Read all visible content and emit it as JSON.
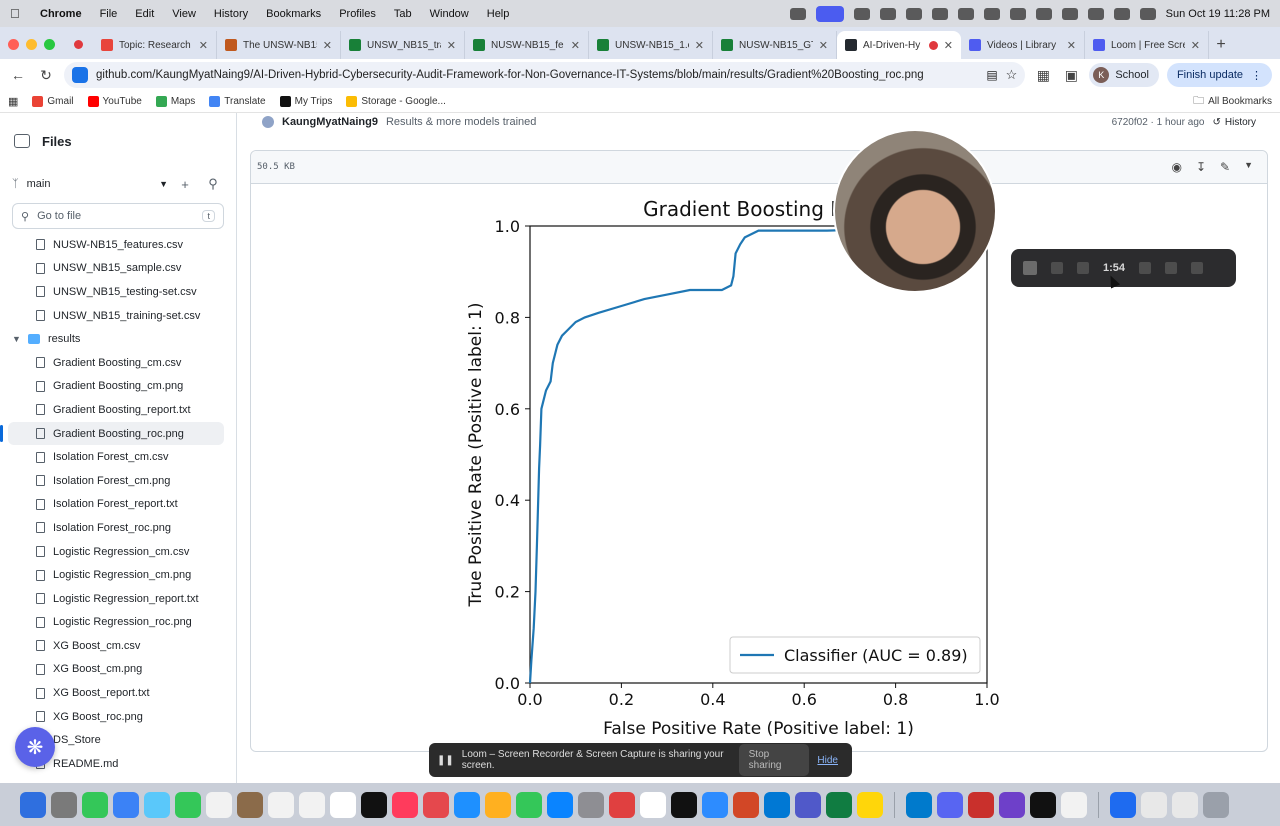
{
  "menubar": {
    "app": "Chrome",
    "items": [
      "File",
      "Edit",
      "View",
      "History",
      "Bookmarks",
      "Profiles",
      "Tab",
      "Window",
      "Help"
    ],
    "clock": "Sun Oct 19  11:28 PM"
  },
  "tabs": [
    {
      "title": "Topic: Research",
      "color": "#e8453c",
      "active": false
    },
    {
      "title": "The UNSW-NB15",
      "color": "#c0591e",
      "active": false
    },
    {
      "title": "UNSW_NB15_tra",
      "color": "#188038",
      "active": false
    },
    {
      "title": "NUSW-NB15_fe",
      "color": "#188038",
      "active": false
    },
    {
      "title": "UNSW-NB15_1.c",
      "color": "#188038",
      "active": false
    },
    {
      "title": "NUSW-NB15_GT",
      "color": "#188038",
      "active": false
    },
    {
      "title": "AI-Driven-Hy",
      "color": "#24292f",
      "active": true
    },
    {
      "title": "Videos | Library",
      "color": "#4f5cf0",
      "active": false
    },
    {
      "title": "Loom | Free Scre",
      "color": "#4f5cf0",
      "active": false
    }
  ],
  "toolbar": {
    "url": "github.com/KaungMyatNaing9/AI-Driven-Hybrid-Cybersecurity-Audit-Framework-for-Non-Governance-IT-Systems/blob/main/results/Gradient%20Boosting_roc.png",
    "profile_label": "School",
    "profile_initial": "K",
    "finish_label": "Finish update"
  },
  "bookmarks": {
    "items": [
      {
        "label": "Gmail",
        "color": "#ea4335"
      },
      {
        "label": "YouTube",
        "color": "#ff0000"
      },
      {
        "label": "Maps",
        "color": "#34a853"
      },
      {
        "label": "Translate",
        "color": "#4285f4"
      },
      {
        "label": "My Trips",
        "color": "#111111"
      },
      {
        "label": "Storage - Google...",
        "color": "#fbbc04"
      }
    ],
    "all_label": "All Bookmarks"
  },
  "sidebar": {
    "title": "Files",
    "branch": "main",
    "goto_placeholder": "Go to file",
    "goto_key": "t",
    "files_top": [
      "NUSW-NB15_features.csv",
      "UNSW_NB15_sample.csv",
      "UNSW_NB15_testing-set.csv",
      "UNSW_NB15_training-set.csv"
    ],
    "folder": "results",
    "results_files": [
      "Gradient Boosting_cm.csv",
      "Gradient Boosting_cm.png",
      "Gradient Boosting_report.txt",
      "Gradient Boosting_roc.png",
      "Isolation Forest_cm.csv",
      "Isolation Forest_cm.png",
      "Isolation Forest_report.txt",
      "Isolation Forest_roc.png",
      "Logistic Regression_cm.csv",
      "Logistic Regression_cm.png",
      "Logistic Regression_report.txt",
      "Logistic Regression_roc.png",
      "XG Boost_cm.csv",
      "XG Boost_cm.png",
      "XG Boost_report.txt",
      "XG Boost_roc.png"
    ],
    "selected": "Gradient Boosting_roc.png",
    "files_bottom": [
      "DS_Store",
      "README.md"
    ]
  },
  "commit": {
    "author": "KaungMyatNaing9",
    "message": "Results & more models trained",
    "meta": "6720f02 · 1 hour ago",
    "history": "History"
  },
  "file": {
    "size": "50.5 KB"
  },
  "chart_data": {
    "type": "line",
    "title": "Gradient Boosting ROC",
    "xlabel": "False Positive Rate (Positive label: 1)",
    "ylabel": "True Positive Rate (Positive label: 1)",
    "xlim": [
      0,
      1
    ],
    "ylim": [
      0,
      1
    ],
    "xticks": [
      "0.0",
      "0.2",
      "0.4",
      "0.6",
      "0.8",
      "1.0"
    ],
    "yticks": [
      "0.0",
      "0.2",
      "0.4",
      "0.6",
      "0.8",
      "1.0"
    ],
    "legend_position": "bottom-right",
    "line_color": "#1f77b4",
    "series": [
      {
        "name": "Classifier (AUC = 0.89)",
        "x": [
          0.0,
          0.003,
          0.008,
          0.012,
          0.015,
          0.018,
          0.02,
          0.022,
          0.025,
          0.03,
          0.035,
          0.045,
          0.05,
          0.055,
          0.06,
          0.07,
          0.08,
          0.1,
          0.12,
          0.15,
          0.2,
          0.25,
          0.3,
          0.35,
          0.4,
          0.42,
          0.44,
          0.445,
          0.45,
          0.46,
          0.47,
          0.5,
          0.55,
          0.65,
          1.0
        ],
        "y": [
          0.0,
          0.05,
          0.12,
          0.2,
          0.3,
          0.4,
          0.47,
          0.52,
          0.6,
          0.62,
          0.64,
          0.66,
          0.7,
          0.72,
          0.74,
          0.76,
          0.77,
          0.79,
          0.8,
          0.81,
          0.825,
          0.84,
          0.85,
          0.86,
          0.86,
          0.86,
          0.87,
          0.89,
          0.94,
          0.96,
          0.975,
          0.99,
          0.99,
          0.99,
          1.0
        ]
      }
    ]
  },
  "overlay": {
    "loom_time": "1:54",
    "share_text": "Loom – Screen Recorder & Screen Capture is sharing your screen.",
    "stop_label": "Stop sharing",
    "hide_label": "Hide"
  },
  "dock": {
    "colors": [
      "#2f6fdf",
      "#7a7a7a",
      "#34c759",
      "#3b82f6",
      "#5ac8fa",
      "#34c759",
      "#f2f2f2",
      "#8b6b4a",
      "#f2f2f2",
      "#f2f2f2",
      "#ffffff",
      "#111111",
      "#ff3b5c",
      "#e5484d",
      "#1e90ff",
      "#ffb020",
      "#34c759",
      "#0a84ff",
      "#8e8e93",
      "#e04040",
      "#ffffff",
      "#111111",
      "#2d8cff",
      "#d24726",
      "#0078d4",
      "#5059c9",
      "#107c41",
      "#ffd60a",
      "#007acc",
      "#5865f2",
      "#c9302c",
      "#6e40c9",
      "#111111",
      "#f2f2f2",
      "#1e6bf0",
      "#e8e8e8",
      "#e8e8e8",
      "#9aa0aa"
    ]
  }
}
